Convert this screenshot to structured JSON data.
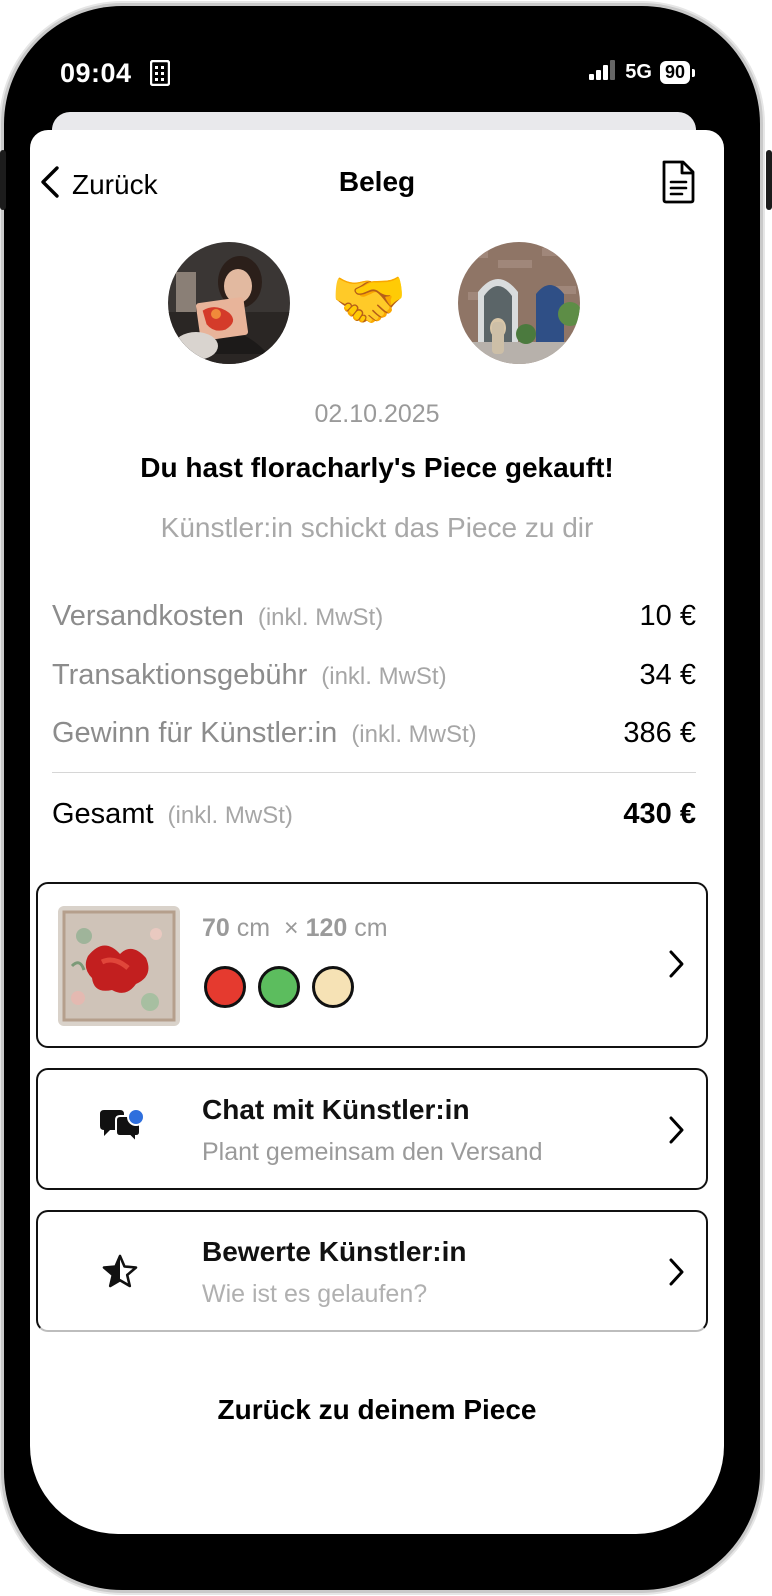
{
  "status_bar": {
    "time": "09:04",
    "network": "5G",
    "battery": "90"
  },
  "nav": {
    "back_label": "Zurück",
    "title": "Beleg"
  },
  "receipt": {
    "date": "02.10.2025",
    "headline": "Du hast floracharly's Piece gekauft!",
    "subline": "Künstler:in schickt das Piece zu dir",
    "rows": [
      {
        "label": "Versandkosten",
        "note": "(inkl. MwSt)",
        "amount": "10 €"
      },
      {
        "label": "Transaktionsgebühr",
        "note": "(inkl. MwSt)",
        "amount": "34 €"
      },
      {
        "label": "Gewinn für Künstler:in",
        "note": "(inkl. MwSt)",
        "amount": "386 €"
      }
    ],
    "total": {
      "label": "Gesamt",
      "note": "(inkl. MwSt)",
      "amount": "430 €"
    }
  },
  "piece": {
    "width_value": "70",
    "width_unit": "cm",
    "times": "×",
    "height_value": "120",
    "height_unit": "cm",
    "colors": [
      "#e53a2f",
      "#5cbd5e",
      "#f6e2b5"
    ]
  },
  "chat": {
    "title": "Chat mit Künstler:in",
    "subtitle": "Plant gemeinsam den Versand",
    "badge_color": "#2f6fdd"
  },
  "rating": {
    "title": "Bewerte Künstler:in",
    "subtitle": "Wie ist es gelaufen?"
  },
  "bottom_link": "Zurück zu deinem Piece",
  "icons": {
    "back": "chevron-left-icon",
    "document": "document-icon",
    "handshake": "handshake-icon",
    "chat": "chat-bubbles-icon",
    "star": "star-icon",
    "chevron": "chevron-right-icon"
  }
}
